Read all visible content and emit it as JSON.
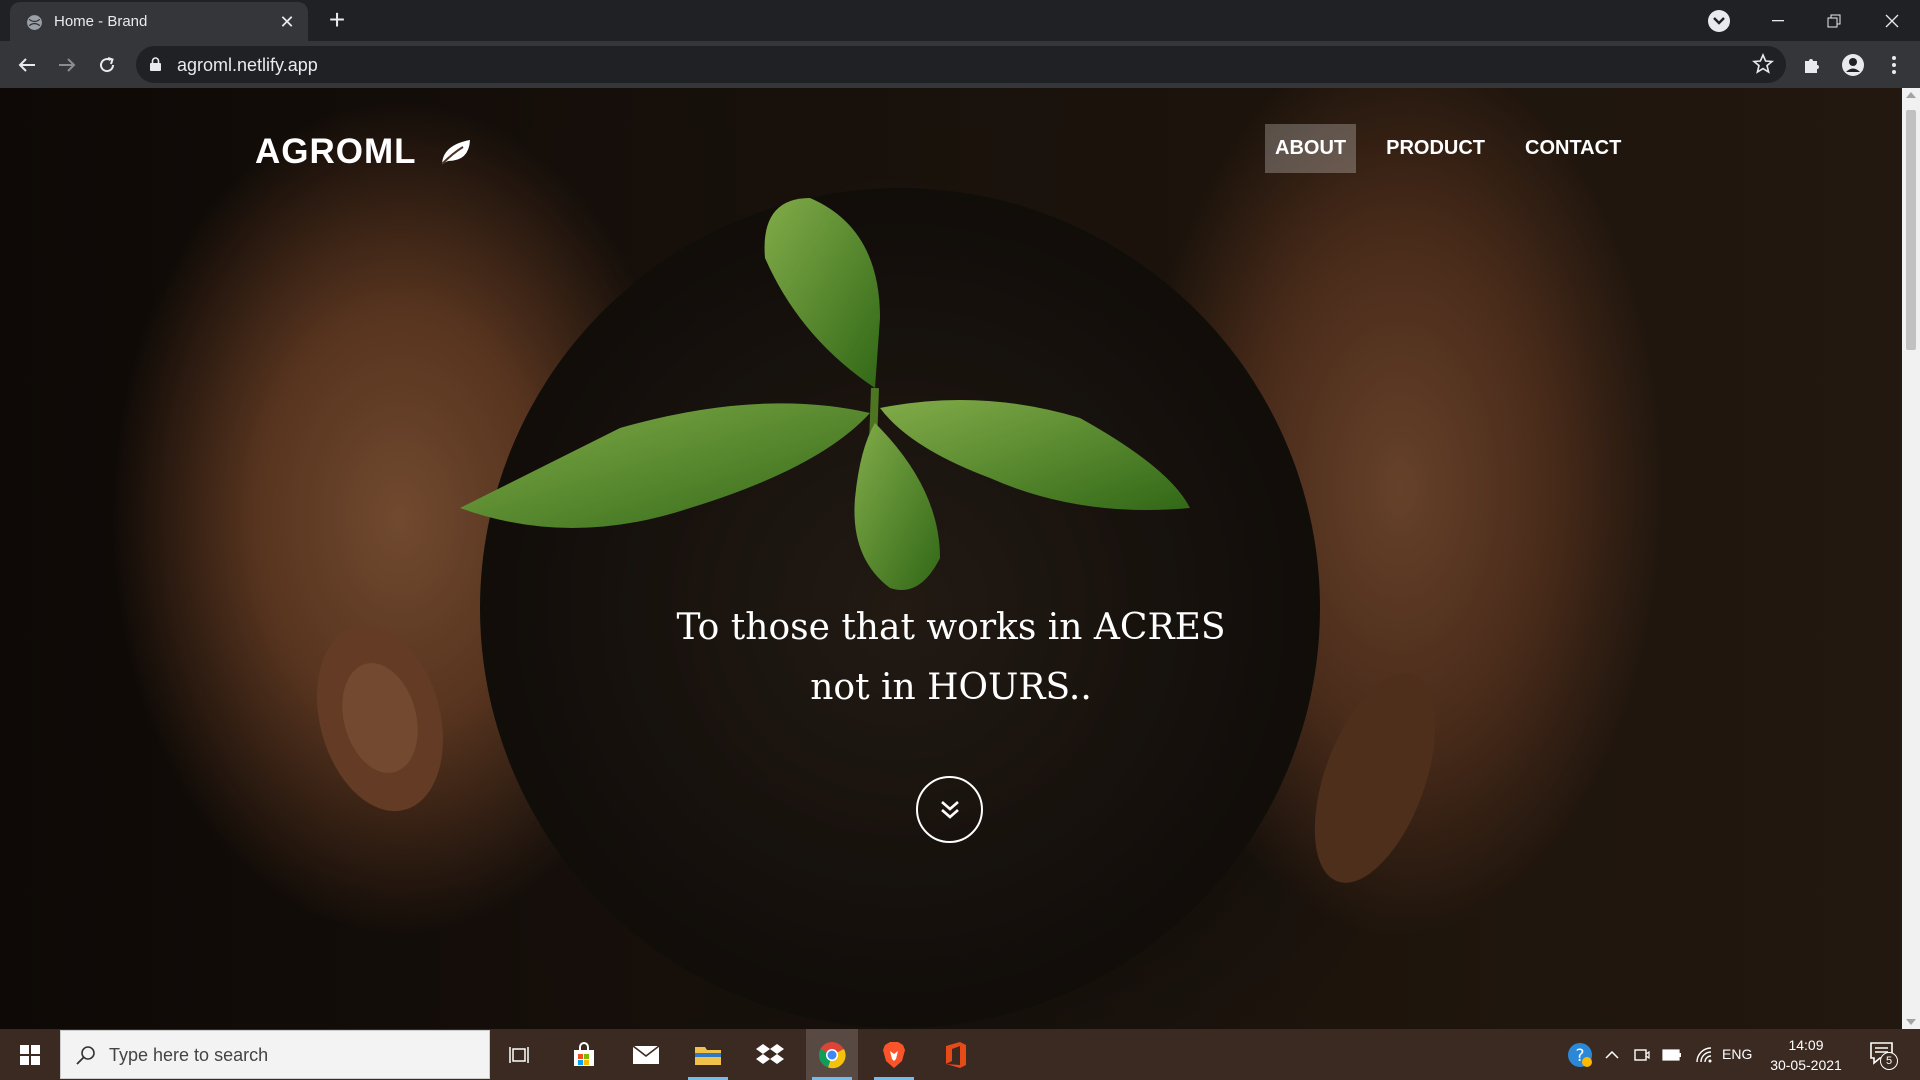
{
  "browser": {
    "tab_title": "Home - Brand",
    "url": "agroml.netlify.app"
  },
  "site": {
    "brand": "AGROML",
    "nav": [
      "ABOUT",
      "PRODUCT",
      "CONTACT"
    ],
    "active_nav": "ABOUT",
    "tagline_line1": "To those that works in ACRES",
    "tagline_line2": "not in HOURS.."
  },
  "taskbar": {
    "search_placeholder": "Type here to search",
    "language": "ENG",
    "time": "14:09",
    "date": "30-05-2021",
    "notification_count": "5"
  },
  "colors": {
    "leaf_green": "#6fae2e",
    "chrome_dark": "#202124",
    "toolbar": "#35363a"
  }
}
